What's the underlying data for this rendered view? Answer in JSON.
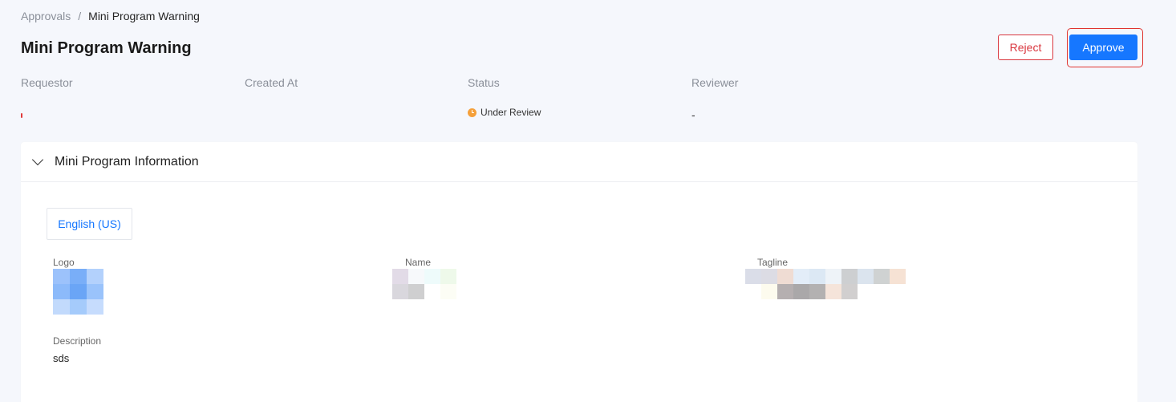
{
  "breadcrumb": {
    "parent": "Approvals",
    "separator": "/",
    "current": "Mini Program Warning"
  },
  "page": {
    "title": "Mini Program Warning"
  },
  "actions": {
    "reject_label": "Reject",
    "approve_label": "Approve"
  },
  "meta": {
    "requestor_label": "Requestor",
    "created_at_label": "Created At",
    "status_label": "Status",
    "reviewer_label": "Reviewer",
    "status_value": "Under Review",
    "reviewer_value": "-"
  },
  "section": {
    "title": "Mini Program Information",
    "language_tab": "English (US)",
    "logo_label": "Logo",
    "name_label": "Name",
    "tagline_label": "Tagline",
    "description_label": "Description",
    "description_value": "sds"
  },
  "colors": {
    "primary": "#1677ff",
    "danger": "#d9363e",
    "status_warning": "#f5a03a"
  }
}
